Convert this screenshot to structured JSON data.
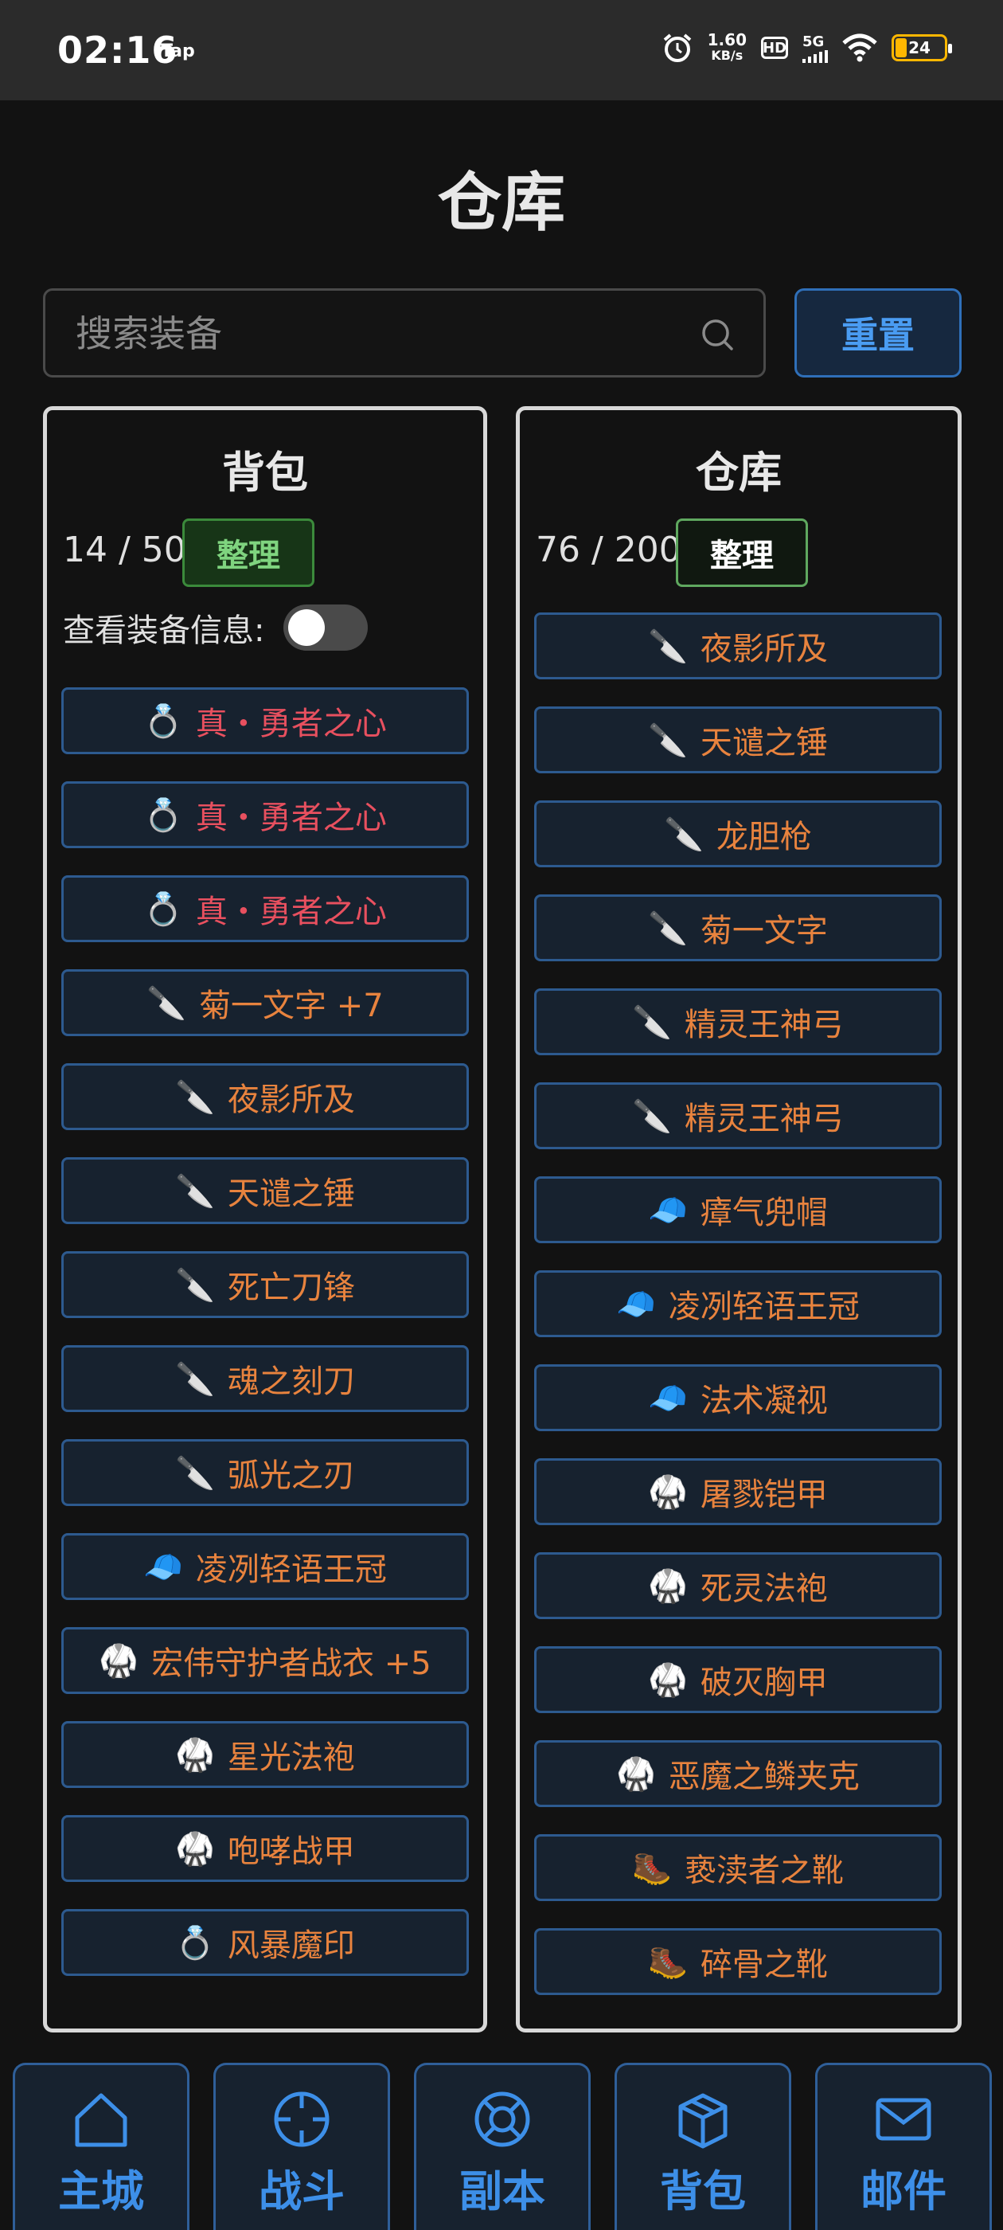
{
  "status": {
    "time": "02:16",
    "tap": "Tap",
    "speed_value": "1.60",
    "speed_unit": "KB/s",
    "hd": "HD",
    "net": "5G",
    "battery": "24"
  },
  "page_title": "仓库",
  "search": {
    "placeholder": "搜索装备",
    "reset_label": "重置"
  },
  "backpack": {
    "title": "背包",
    "count": "14 / 50",
    "sort_label": "整理",
    "toggle_label": "查看装备信息:",
    "items": [
      {
        "icon": "💍",
        "name": "真・勇者之心",
        "color": "red"
      },
      {
        "icon": "💍",
        "name": "真・勇者之心",
        "color": "red"
      },
      {
        "icon": "💍",
        "name": "真・勇者之心",
        "color": "red"
      },
      {
        "icon": "🔪",
        "name": "菊一文字 +7",
        "color": "orange"
      },
      {
        "icon": "🔪",
        "name": "夜影所及",
        "color": "orange"
      },
      {
        "icon": "🔪",
        "name": "天谴之锤",
        "color": "orange"
      },
      {
        "icon": "🔪",
        "name": "死亡刀锋",
        "color": "orange"
      },
      {
        "icon": "🔪",
        "name": "魂之刻刀",
        "color": "orange"
      },
      {
        "icon": "🔪",
        "name": "弧光之刃",
        "color": "orange"
      },
      {
        "icon": "🧢",
        "name": "凌冽轻语王冠",
        "color": "orange"
      },
      {
        "icon": "🥋",
        "name": "宏伟守护者战衣 +5",
        "color": "orange"
      },
      {
        "icon": "🥋",
        "name": "星光法袍",
        "color": "orange"
      },
      {
        "icon": "🥋",
        "name": "咆哮战甲",
        "color": "orange"
      },
      {
        "icon": "💍",
        "name": "风暴魔印",
        "color": "orange"
      }
    ]
  },
  "warehouse": {
    "title": "仓库",
    "count": "76 / 200",
    "sort_label": "整理",
    "items": [
      {
        "icon": "🔪",
        "name": "夜影所及",
        "color": "orange"
      },
      {
        "icon": "🔪",
        "name": "天谴之锤",
        "color": "orange"
      },
      {
        "icon": "🔪",
        "name": "龙胆枪",
        "color": "orange"
      },
      {
        "icon": "🔪",
        "name": "菊一文字",
        "color": "orange"
      },
      {
        "icon": "🔪",
        "name": "精灵王神弓",
        "color": "orange"
      },
      {
        "icon": "🔪",
        "name": "精灵王神弓",
        "color": "orange"
      },
      {
        "icon": "🧢",
        "name": "瘴气兜帽",
        "color": "orange"
      },
      {
        "icon": "🧢",
        "name": "凌冽轻语王冠",
        "color": "orange"
      },
      {
        "icon": "🧢",
        "name": "法术凝视",
        "color": "orange"
      },
      {
        "icon": "🥋",
        "name": "屠戮铠甲",
        "color": "orange"
      },
      {
        "icon": "🥋",
        "name": "死灵法袍",
        "color": "orange"
      },
      {
        "icon": "🥋",
        "name": "破灭胸甲",
        "color": "orange"
      },
      {
        "icon": "🥋",
        "name": "恶魔之鳞夹克",
        "color": "orange"
      },
      {
        "icon": "🥾",
        "name": "亵渎者之靴",
        "color": "orange"
      },
      {
        "icon": "🥾",
        "name": "碎骨之靴",
        "color": "orange"
      }
    ]
  },
  "nav": [
    {
      "label": "主城",
      "icon": "home-icon"
    },
    {
      "label": "战斗",
      "icon": "crosshair-icon"
    },
    {
      "label": "副本",
      "icon": "lifebuoy-icon"
    },
    {
      "label": "背包",
      "icon": "package-icon"
    },
    {
      "label": "邮件",
      "icon": "mail-icon"
    }
  ],
  "colors": {
    "accent_blue": "#3d8fe8",
    "item_red": "#e8505f",
    "item_orange": "#e8833e",
    "sort_green": "#7fd47f"
  }
}
